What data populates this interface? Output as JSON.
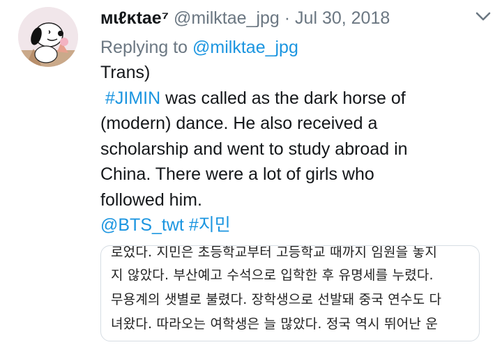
{
  "tweet": {
    "display_name": "ᴍɩℓĸtae⁷",
    "handle": "@milktae_jpg",
    "separator": "·",
    "date": "Jul 30, 2018",
    "replying_prefix": "Replying to",
    "replying_handle": "@milktae_jpg",
    "body": {
      "line1": "Trans)",
      "hashtag1": "#JIMIN",
      "line2_rest": " was called as the dark horse of",
      "line3": "(modern) dance. He also received a",
      "line4": "scholarship and went to study abroad in",
      "line5": "China. There were a lot of girls who",
      "line6": "followed him.",
      "mention": "@BTS_twt",
      "hashtag2": "#지민"
    },
    "media_lines": [
      "로었다. 지민은 초등학교부터 고등학교 때까지 임원을 놓지",
      "지 않았다. 부산예고 수석으로 입학한 후 유명세를 누렸다.",
      "무용계의 샛별로 불렸다. 장학생으로 선발돼 중국 연수도 다",
      "녀왔다. 따라오는 여학생은 늘 많았다. 정국 역시 뛰어난 운"
    ]
  },
  "icons": {
    "avatar": "snoopy-avatar-icon",
    "menu": "chevron-down-icon"
  }
}
